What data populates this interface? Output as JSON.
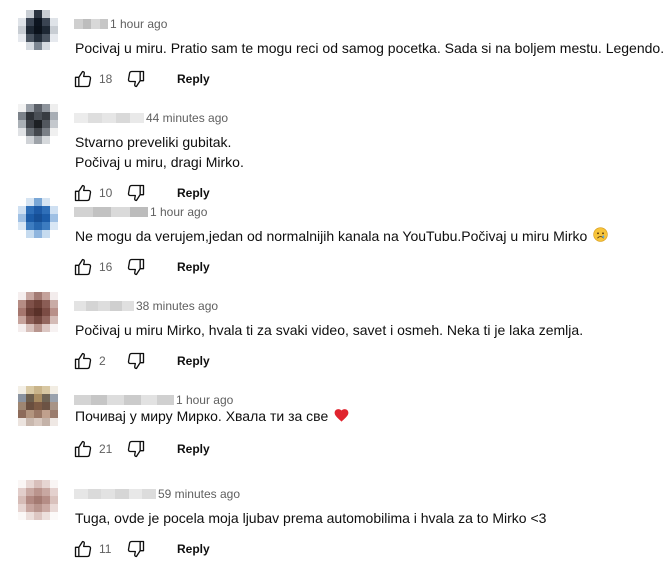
{
  "comments": [
    {
      "time": "1 hour ago",
      "lines": [
        "Pocivaj u miru. Pratio sam te mogu reci od samog pocetka. Sada si na boljem mestu. Legendo."
      ],
      "likes": "18",
      "reply": "Reply",
      "avatar_colors": [
        "#ffffff",
        "#c9ced4",
        "#2b3440",
        "#c9ced4",
        "#ffffff",
        "#dfe3e8",
        "#3a4452",
        "#0d1520",
        "#3a4452",
        "#dfe3e8",
        "#c8cdd3",
        "#1e2834",
        "#0b121b",
        "#1e2834",
        "#c8cdd3",
        "#e6e9ee",
        "#4a5460",
        "#222c38",
        "#4a5460",
        "#e6e9ee",
        "#ffffff",
        "#d6dbe1",
        "#7d8792",
        "#d6dbe1",
        "#ffffff"
      ],
      "name_blur": [
        "#cfcfcf",
        "#bdbdbd",
        "#d8d8d8",
        "#c6c6c6"
      ]
    },
    {
      "time": "44 minutes ago",
      "lines": [
        "Stvarno preveliki gubitak.",
        "Počivaj u miru, dragi Mirko."
      ],
      "likes": "10",
      "reply": "Reply",
      "avatar_colors": [
        "#f2f2f2",
        "#9aa0a8",
        "#5b6068",
        "#8e949c",
        "#eeeeee",
        "#7c828a",
        "#2e3238",
        "#4a4f56",
        "#383c42",
        "#a8aeb5",
        "#aab0b6",
        "#3d4148",
        "#1d2024",
        "#52575e",
        "#c4c8cd",
        "#e0e2e5",
        "#6a7077",
        "#43474d",
        "#7a7f86",
        "#f0f0f0",
        "#ffffff",
        "#d0d3d7",
        "#9ea3a9",
        "#d6d9dc",
        "#ffffff"
      ],
      "name_blur": [
        "#ececec",
        "#dedede",
        "#e6e6e6",
        "#d9d9d9",
        "#e9e9e9"
      ]
    },
    {
      "time": "1 hour ago",
      "lines": [
        "Ne mogu da verujem,jedan od normalnijih kanala na YouTubu.Počivaj u miru Mirko"
      ],
      "emoji": "😢",
      "likes": "16",
      "reply": "Reply",
      "avatar_colors": [
        "#ffffff",
        "#d6e4f2",
        "#7aa7d6",
        "#d6e4f2",
        "#ffffff",
        "#cfe0f2",
        "#2f6fb8",
        "#1d5aa6",
        "#2f6fb8",
        "#cfe0f2",
        "#9fc0e4",
        "#1c5ca8",
        "#164f96",
        "#1c5ca8",
        "#9fc0e4",
        "#d9e7f5",
        "#3d7cc0",
        "#2767af",
        "#3d7cc0",
        "#d9e7f5",
        "#ffffff",
        "#c6dbef",
        "#8fb5de",
        "#c6dbef",
        "#ffffff"
      ],
      "name_blur": [
        "#d2d2d2",
        "#c2c2c2",
        "#dadada",
        "#bcbcbc"
      ]
    },
    {
      "time": "38 minutes ago",
      "lines": [
        "Počivaj u miru Mirko, hvala ti za svaki video, savet i osmeh. Neka ti je laka zemlja."
      ],
      "likes": "2",
      "reply": "Reply",
      "avatar_colors": [
        "#f5eeee",
        "#c8a8a2",
        "#a37b74",
        "#c4a29b",
        "#f3ecec",
        "#b58c84",
        "#7f5149",
        "#6d4037",
        "#8a5d55",
        "#c9aca6",
        "#a5766e",
        "#6b3f37",
        "#5a3129",
        "#7b4c44",
        "#b89089",
        "#c6a39c",
        "#8c5f57",
        "#744840",
        "#93675f",
        "#d4bbb6",
        "#f4eded",
        "#d7c0bb",
        "#b8958e",
        "#dcc7c3",
        "#f7f2f2"
      ],
      "name_blur": [
        "#e3e3e3",
        "#d4d4d4",
        "#dddddd",
        "#cfcfcf",
        "#e0e0e0"
      ]
    },
    {
      "time": "1 hour ago",
      "lines": [
        "Почивај у миру Мирко. Хвала ти за све"
      ],
      "emoji": "heart",
      "likes": "21",
      "reply": "Reply",
      "avatar_colors": [
        "#f3efe6",
        "#d9c9a4",
        "#c9b48a",
        "#d8c7a2",
        "#f2ede3",
        "#8a93a0",
        "#6d5f4e",
        "#a88c62",
        "#6f6455",
        "#9aa2ad",
        "#9e8672",
        "#6a4f3f",
        "#7d5b45",
        "#6c5344",
        "#a89486",
        "#8d6b5a",
        "#b3957f",
        "#9a7866",
        "#c0a08d",
        "#9b7d6e",
        "#ece4df",
        "#c9b8ae",
        "#d8c8bf",
        "#c4b2a8",
        "#efe8e4"
      ],
      "name_blur": [
        "#d4d4d4",
        "#c6c6c6",
        "#dddddd",
        "#cbcbcb",
        "#e2e2e2",
        "#d0d0d0"
      ]
    },
    {
      "time": "59 minutes ago",
      "lines": [
        "Tuga, ovde je pocela moja ljubav prema automobilima i hvala za to Mirko <3"
      ],
      "likes": "11",
      "reply": "Reply",
      "avatar_colors": [
        "#faf6f5",
        "#e8d8d5",
        "#d8bfbb",
        "#e6d5d2",
        "#f9f5f4",
        "#e2cecb",
        "#c9a9a3",
        "#ba948d",
        "#c8a7a1",
        "#e4d1ce",
        "#d6bcb7",
        "#b38a83",
        "#a47a72",
        "#b58d86",
        "#d9c1bc",
        "#e6d4d1",
        "#c8a6a0",
        "#b9958e",
        "#cbaaa4",
        "#e9d9d6",
        "#fbf8f7",
        "#ecdfdc",
        "#ddc7c3",
        "#ece0dd",
        "#fcfaf9"
      ],
      "name_blur": [
        "#e6e6e6",
        "#dadada",
        "#e2e2e2",
        "#d6d6d6",
        "#e8e8e8",
        "#dcdcdc"
      ]
    }
  ],
  "icons": {
    "like": "thumbs-up-icon",
    "dislike": "thumbs-down-icon"
  },
  "colors": {
    "text": "#0f0f0f",
    "secondary": "#606060",
    "heart": "#e0242e"
  }
}
